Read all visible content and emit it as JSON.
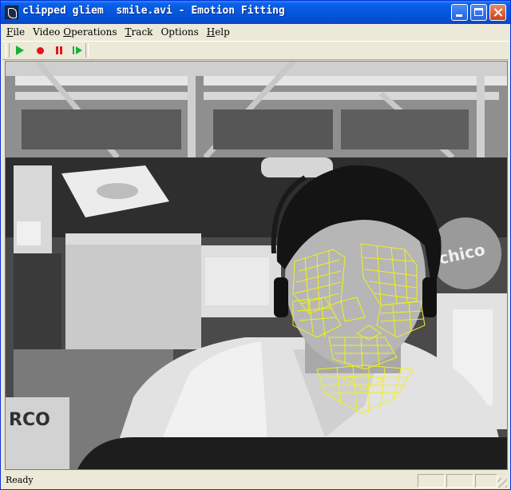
{
  "window": {
    "title": "clipped gliem  smile.avi - Emotion Fitting",
    "app_icon": "emotion-app-icon",
    "controls": {
      "minimize_icon": "minimize-icon",
      "maximize_icon": "maximize-icon",
      "close_icon": "close-icon"
    }
  },
  "menu": [
    {
      "accel": "F",
      "rest": "ile"
    },
    {
      "accel": "",
      "rest": "Video "
    },
    {
      "accel": "O",
      "rest": "perations"
    },
    {
      "accel": "T",
      "rest": "rack"
    },
    {
      "accel": "",
      "rest": "Options"
    },
    {
      "accel": "H",
      "rest": "elp"
    }
  ],
  "toolbar": {
    "buttons": [
      {
        "icon": "play-icon",
        "color": "#16b03a"
      },
      {
        "icon": "record-icon",
        "color": "#e3151a"
      },
      {
        "icon": "pause-icon",
        "color": "#e3151a"
      },
      {
        "icon": "step-forward-icon",
        "color": "#16b03a"
      }
    ]
  },
  "video": {
    "content": "grayscale video frame of person wearing headset with yellow face-fitting mesh",
    "mesh_color": "#f2f21a"
  },
  "status": {
    "text": "Ready"
  }
}
